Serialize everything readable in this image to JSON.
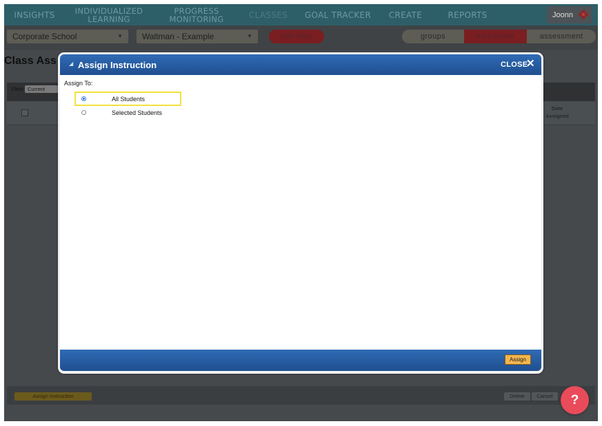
{
  "nav": {
    "items": [
      {
        "label": "INSIGHTS"
      },
      {
        "label1": "INDIVIDUALIZED",
        "label2": "LEARNING"
      },
      {
        "label1": "PROGRESS",
        "label2": "MONITORING"
      },
      {
        "label": "CLASSES"
      },
      {
        "label": "GOAL TRACKER"
      },
      {
        "label": "CREATE"
      },
      {
        "label": "REPORTS"
      }
    ],
    "user_label": "Joonn"
  },
  "subbar": {
    "school_select": "Corporate School",
    "class_select": "Waltman - Example",
    "edit_class": "edit class",
    "segments": [
      "groups",
      "instruction",
      "assessment"
    ]
  },
  "page": {
    "title": "Class Ass",
    "view_label": "View:",
    "view_value": "Current",
    "date_col1": "Date",
    "date_col2": "Assigned",
    "assign_instruction_btn": "Assign Instruction",
    "delete_btn": "Delete",
    "cancel_btn": "Cancel"
  },
  "modal": {
    "title": "Assign Instruction",
    "close_label": "CLOSE",
    "assign_to_label": "Assign To:",
    "options": [
      "All Students",
      "Selected Students"
    ],
    "selected_option": "All Students",
    "assign_button": "Assign"
  },
  "help": {
    "label": "?"
  },
  "colors": {
    "nav_bg": "#2d5f69",
    "modal_header": "#2f6bb5",
    "assign_btn": "#f2b64f",
    "highlight": "#f2e23c",
    "help_btn": "#ea4b5a"
  }
}
